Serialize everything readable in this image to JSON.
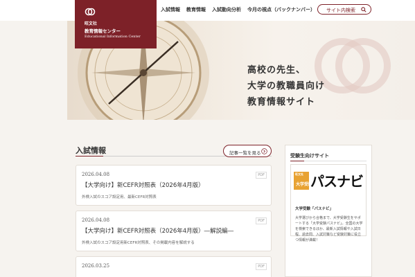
{
  "header": {
    "nav": [
      "入試情報",
      "教育情報",
      "入試動向分析",
      "今月の視点（バックナンバー）"
    ],
    "search": {
      "placeholder": "サイト内検索",
      "icon": "search-icon"
    }
  },
  "logo": {
    "name": "旺文社",
    "center": "教育情報センター",
    "en": "Educational Information Center",
    "color": "#7d2128"
  },
  "hero": {
    "lines": [
      "高校の先生、",
      "大学の教職員向け",
      "教育情報サイト"
    ]
  },
  "main": {
    "section_title": "入試情報",
    "more_label": "記事一覧を見る",
    "cards": [
      {
        "date": "2026.04.08",
        "badge": "PDF",
        "title": "【大学向け】新CEFR対照表（2026年4月版）",
        "desc": "外検入試のスコア設定用、最新CEFR対照表"
      },
      {
        "date": "2026.04.08",
        "badge": "PDF",
        "title": "【大学向け】新CEFR対照表（2026年4月版）―解説編―",
        "desc": "外検入試のスコア設定用新CEFR対照表、その掲載内容を解説する"
      },
      {
        "date": "2026.03.25",
        "badge": "PDF",
        "title": "",
        "desc": ""
      }
    ]
  },
  "sidebar": {
    "title": "受験生向けサイト",
    "banner": {
      "mini_top": "旺文社",
      "mini_bottom": "大学受験",
      "logo": "パスナビ",
      "caption": "大学受験「パスナビ」",
      "desc": "大学選びから合格まで、大学受験生をサポートする「大学受験パスナビ」。全国の大学を検索できるほか、最新入試情報や入試日程、過去問、入試対策など受験対策に役立つ情報が満載！"
    }
  }
}
